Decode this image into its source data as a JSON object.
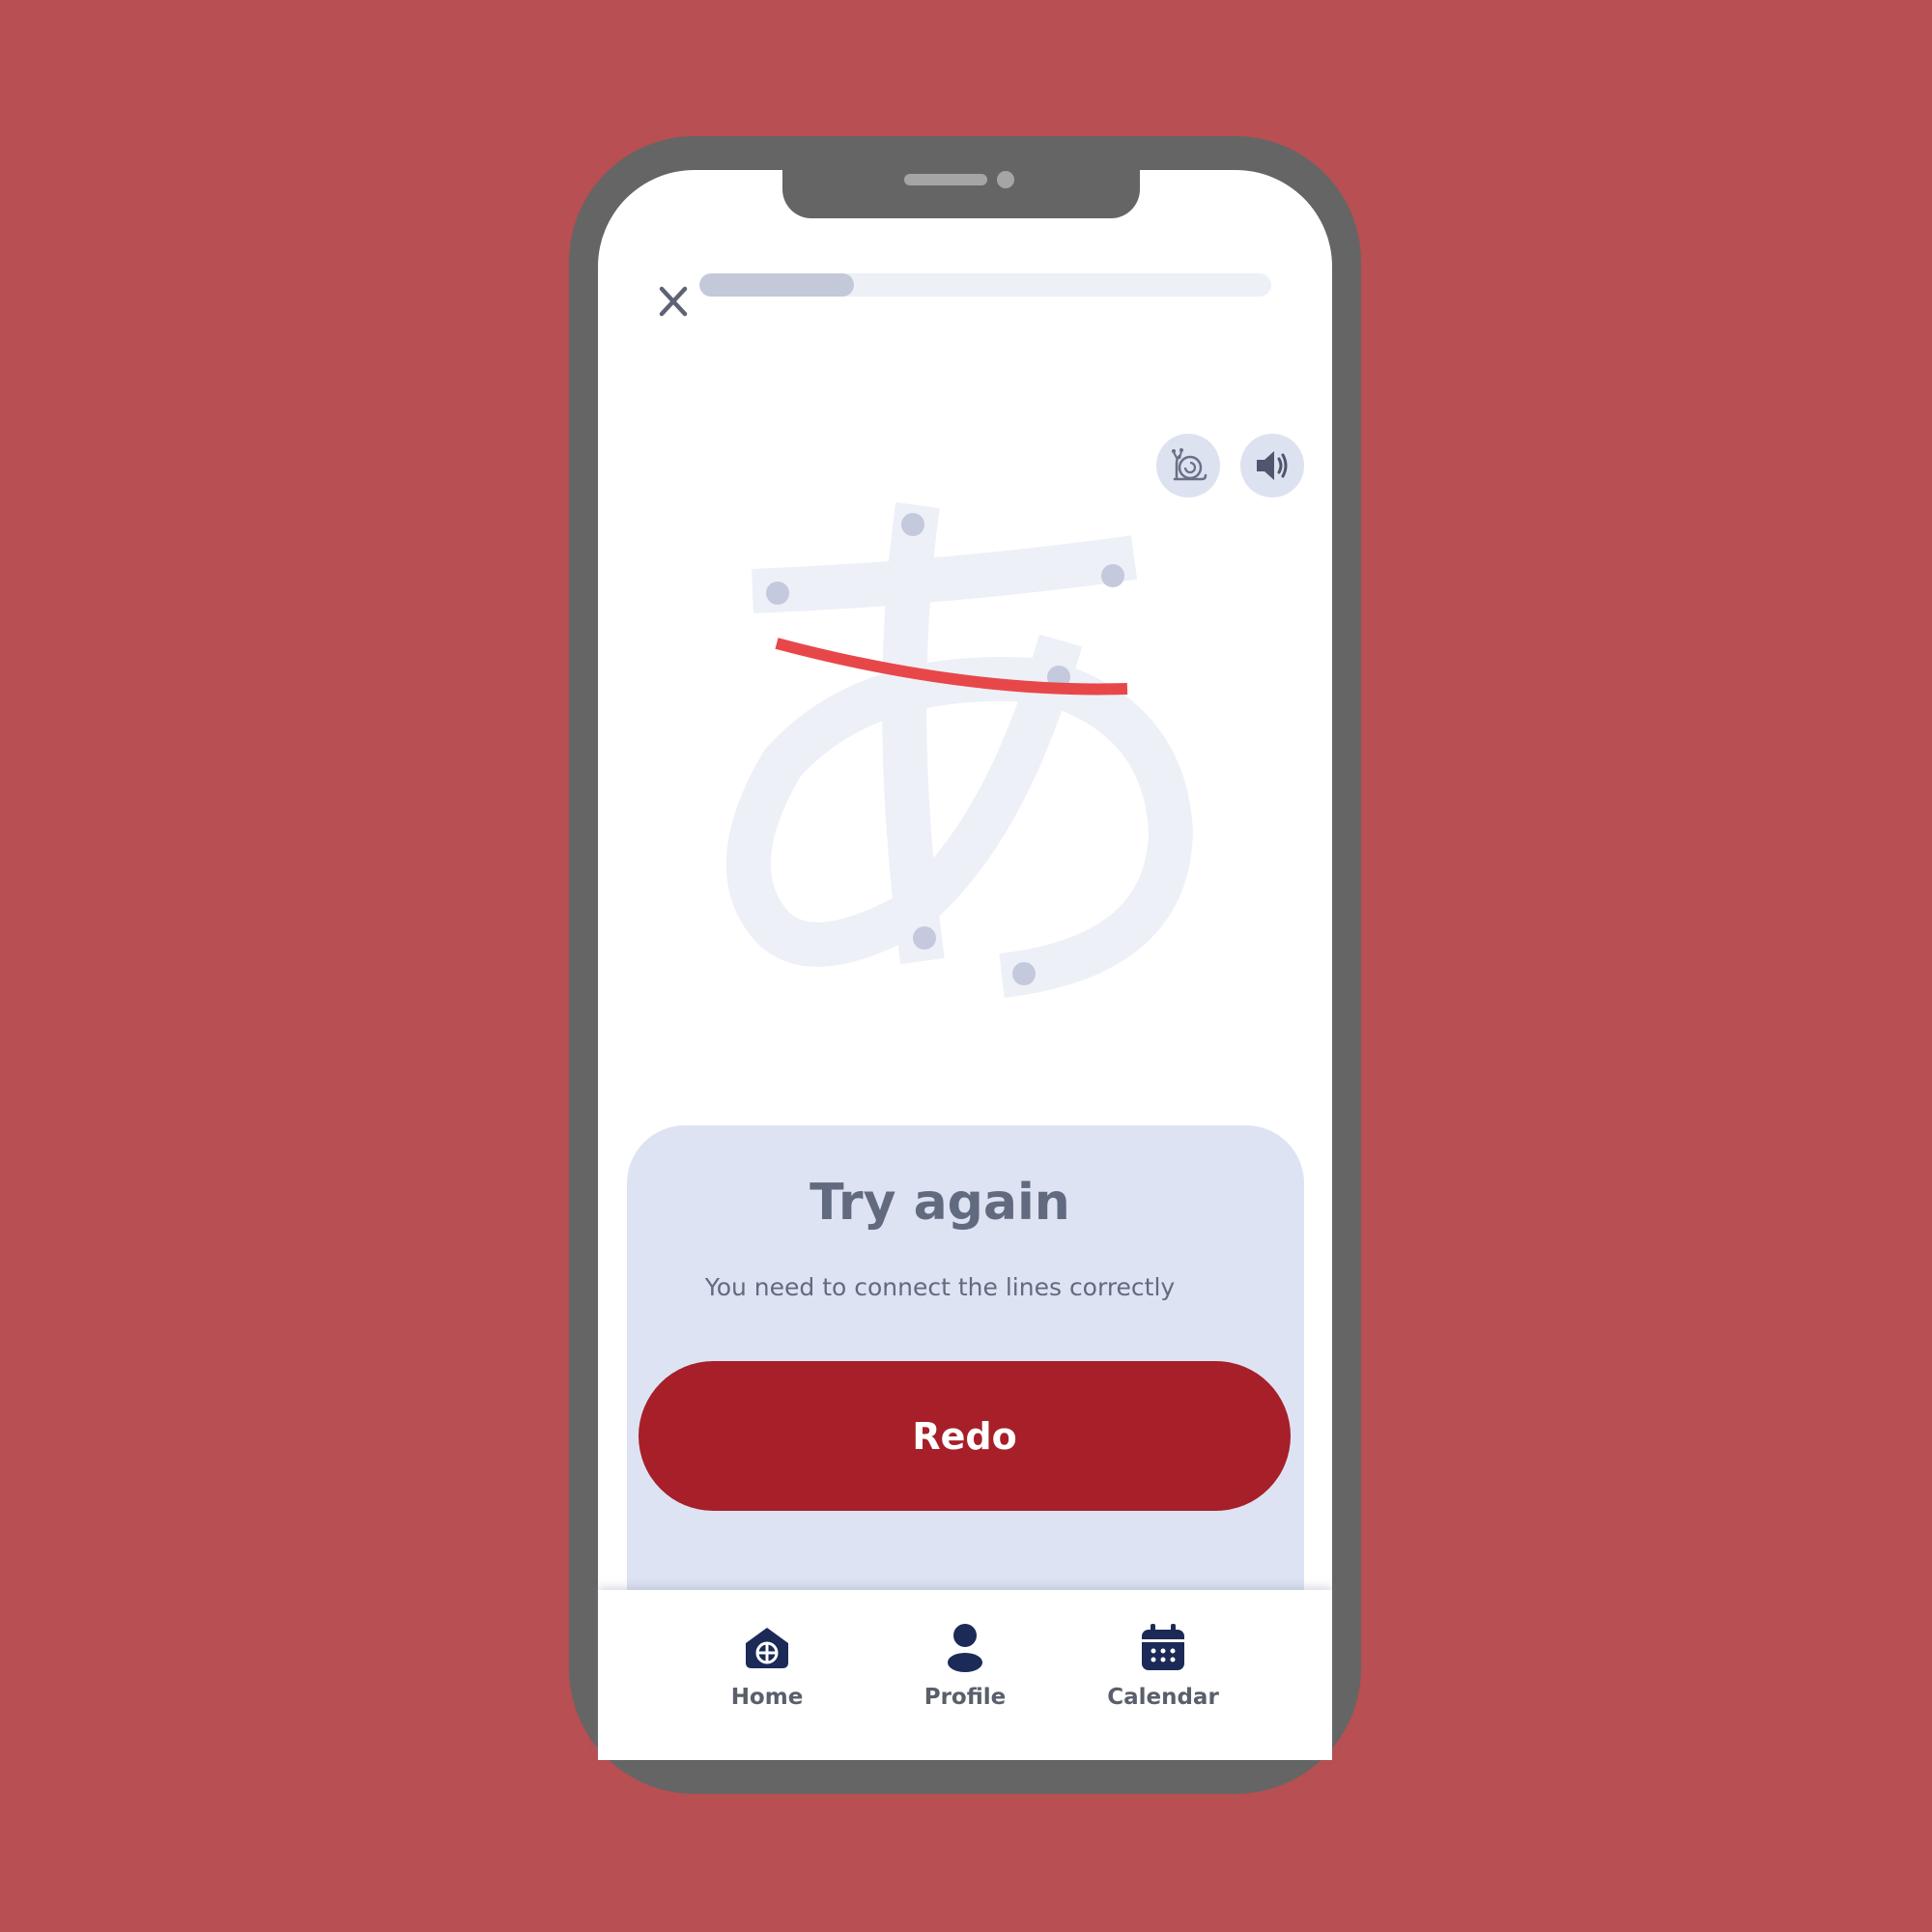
{
  "lesson": {
    "progress_fraction": 0.27,
    "character": "あ"
  },
  "controls": {
    "close_icon": "close-icon",
    "slow_icon": "snail-icon",
    "sound_icon": "speaker-icon"
  },
  "feedback": {
    "title": "Try again",
    "message": "You need to connect the lines correctly",
    "redo_label": "Redo"
  },
  "nav": {
    "items": [
      {
        "label": "Home",
        "icon": "home-icon"
      },
      {
        "label": "Profile",
        "icon": "profile-icon"
      },
      {
        "label": "Calendar",
        "icon": "calendar-icon"
      }
    ]
  },
  "colors": {
    "background": "#b84f52",
    "phone_frame": "#656565",
    "panel": "#dde3f3",
    "accent": "#a71f28",
    "user_stroke": "#e8474a",
    "guide_stroke": "#edf0f7",
    "guide_dot": "#c4c9dd",
    "nav_icon": "#1b2a57"
  }
}
